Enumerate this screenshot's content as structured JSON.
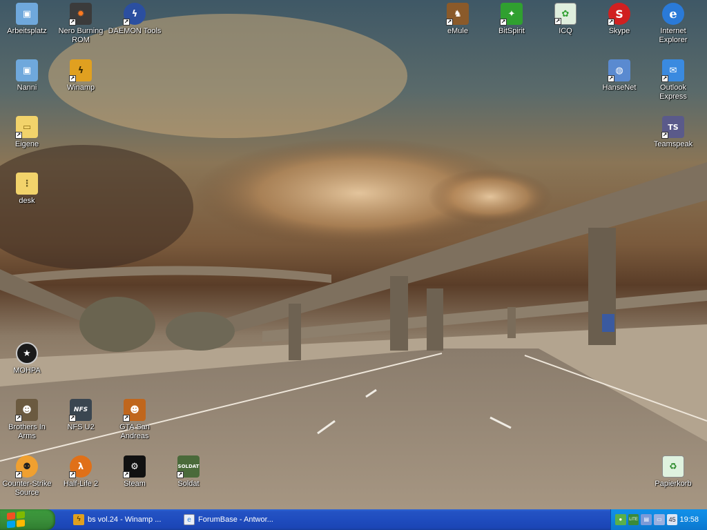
{
  "desktop": {
    "icons": [
      {
        "name": "icon-arbeitsplatz",
        "label": "Arbeitsplatz",
        "icon": "my-computer-icon",
        "shortcut": false,
        "color": "#6fa8dc"
      },
      {
        "name": "icon-nero",
        "label": "Nero Burning ROM",
        "icon": "nero-flame-icon",
        "shortcut": true,
        "color": "#3b3b3b"
      },
      {
        "name": "icon-daemon-tools",
        "label": "DAEMON Tools",
        "icon": "daemon-lightning-icon",
        "shortcut": true,
        "color": "#2b4fa0"
      },
      {
        "name": "icon-nanni",
        "label": "Nanni",
        "icon": "network-computer-icon",
        "shortcut": false,
        "color": "#6fa8dc"
      },
      {
        "name": "icon-winamp",
        "label": "Winamp",
        "icon": "winamp-lightning-icon",
        "shortcut": true,
        "color": "#e0a020"
      },
      {
        "name": "icon-eigene",
        "label": "Eigene",
        "icon": "folder-icon",
        "shortcut": true,
        "color": "#f2d36b"
      },
      {
        "name": "icon-desk",
        "label": "desk",
        "icon": "zip-folder-icon",
        "shortcut": false,
        "color": "#f2d36b"
      },
      {
        "name": "icon-mohpa",
        "label": "MOHPA",
        "icon": "medal-star-icon",
        "shortcut": false,
        "color": "#1a1a1a"
      },
      {
        "name": "icon-brothers-in-arms",
        "label": "Brothers In Arms",
        "icon": "soldier-portrait-icon",
        "shortcut": true,
        "color": "#6b5a40"
      },
      {
        "name": "icon-nfs-u2",
        "label": "NFS U2",
        "icon": "nfs-logo-icon",
        "shortcut": true,
        "color": "#3a4650"
      },
      {
        "name": "icon-gta-sa",
        "label": "GTA San Andreas",
        "icon": "gta-portrait-icon",
        "shortcut": true,
        "color": "#c0661c"
      },
      {
        "name": "icon-counter-strike",
        "label": "Counter-Strike Source",
        "icon": "cs-soldier-icon",
        "shortcut": true,
        "color": "#f0a030"
      },
      {
        "name": "icon-half-life-2",
        "label": "Half-Life 2",
        "icon": "lambda-icon",
        "shortcut": true,
        "color": "#e07018"
      },
      {
        "name": "icon-steam",
        "label": "Steam",
        "icon": "steam-icon",
        "shortcut": true,
        "color": "#111111"
      },
      {
        "name": "icon-soldat",
        "label": "Soldat",
        "icon": "soldat-logo-icon",
        "shortcut": true,
        "color": "#4a6a3a"
      },
      {
        "name": "icon-emule",
        "label": "eMule",
        "icon": "emule-mule-icon",
        "shortcut": true,
        "color": "#8a5a2a"
      },
      {
        "name": "icon-bitspirit",
        "label": "BitSpirit",
        "icon": "bitspirit-icon",
        "shortcut": true,
        "color": "#30a030"
      },
      {
        "name": "icon-icq",
        "label": "ICQ",
        "icon": "icq-flower-icon",
        "shortcut": true,
        "color": "#40b040"
      },
      {
        "name": "icon-skype",
        "label": "Skype",
        "icon": "skype-icon",
        "shortcut": true,
        "color": "#d02020"
      },
      {
        "name": "icon-internet-explorer",
        "label": "Internet Explorer",
        "icon": "ie-logo-icon",
        "shortcut": false,
        "color": "#2a7ad8"
      },
      {
        "name": "icon-hansenet",
        "label": "HanseNet",
        "icon": "network-globe-icon",
        "shortcut": true,
        "color": "#5a8ad0"
      },
      {
        "name": "icon-outlook-express",
        "label": "Outlook Express",
        "icon": "outlook-express-icon",
        "shortcut": true,
        "color": "#3a8ae0"
      },
      {
        "name": "icon-teamspeak",
        "label": "Teamspeak",
        "icon": "teamspeak-icon",
        "shortcut": true,
        "color": "#5a5a8a"
      },
      {
        "name": "icon-papierkorb",
        "label": "Papierkorb",
        "icon": "recycle-bin-icon",
        "shortcut": false,
        "color": "#7ac07a"
      }
    ]
  },
  "taskbar": {
    "start_icon": "windows-logo-icon",
    "tasks": [
      {
        "label": "bs vol.24 - Winamp ...",
        "icon": "winamp-lightning-icon"
      },
      {
        "label": "ForumBase - Antwor...",
        "icon": "ie-logo-icon"
      }
    ],
    "tray": {
      "icons": [
        "messenger-icon",
        "network-lite-icon",
        "network-connection-icon",
        "display-icon",
        "volume-icon"
      ],
      "volume_label": "45",
      "clock": "19:58"
    }
  }
}
